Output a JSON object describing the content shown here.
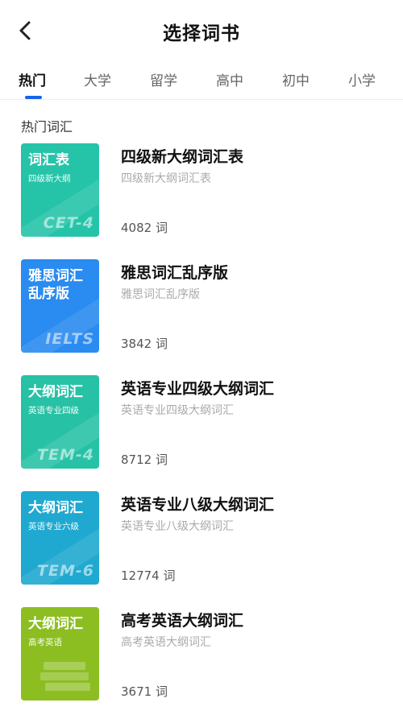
{
  "header": {
    "title": "选择词书",
    "back_icon": "chevron-left-icon"
  },
  "tabs": [
    {
      "label": "热门",
      "active": true
    },
    {
      "label": "大学",
      "active": false
    },
    {
      "label": "留学",
      "active": false
    },
    {
      "label": "高中",
      "active": false
    },
    {
      "label": "初中",
      "active": false
    },
    {
      "label": "小学",
      "active": false
    }
  ],
  "accent_color": "#1565e8",
  "section": {
    "title": "热门词汇"
  },
  "books": [
    {
      "cover_title": "词汇表",
      "cover_sub": "四级新大纲",
      "cover_code": "CET-4",
      "cover_color": "#25c4a9",
      "name": "四级新大纲词汇表",
      "desc": "四级新大纲词汇表",
      "count": "4082 词"
    },
    {
      "cover_title": "雅思词汇乱序版",
      "cover_sub": "",
      "cover_code": "IELTS",
      "cover_color": "#2a8bf0",
      "name": "雅思词汇乱序版",
      "desc": "雅思词汇乱序版",
      "count": "3842 词"
    },
    {
      "cover_title": "大纲词汇",
      "cover_sub": "英语专业四级",
      "cover_code": "TEM-4",
      "cover_color": "#27c2a6",
      "name": "英语专业四级大纲词汇",
      "desc": "英语专业四级大纲词汇",
      "count": "8712 词"
    },
    {
      "cover_title": "大纲词汇",
      "cover_sub": "英语专业六级",
      "cover_code": "TEM-6",
      "cover_color": "#1fa9d0",
      "name": "英语专业八级大纲词汇",
      "desc": "英语专业八级大纲词汇",
      "count": "12774 词"
    },
    {
      "cover_title": "大纲词汇",
      "cover_sub": "高考英语",
      "cover_code": "",
      "cover_color": "#8cbe22",
      "name": "高考英语大纲词汇",
      "desc": "高考英语大纲词汇",
      "count": "3671 词"
    }
  ]
}
